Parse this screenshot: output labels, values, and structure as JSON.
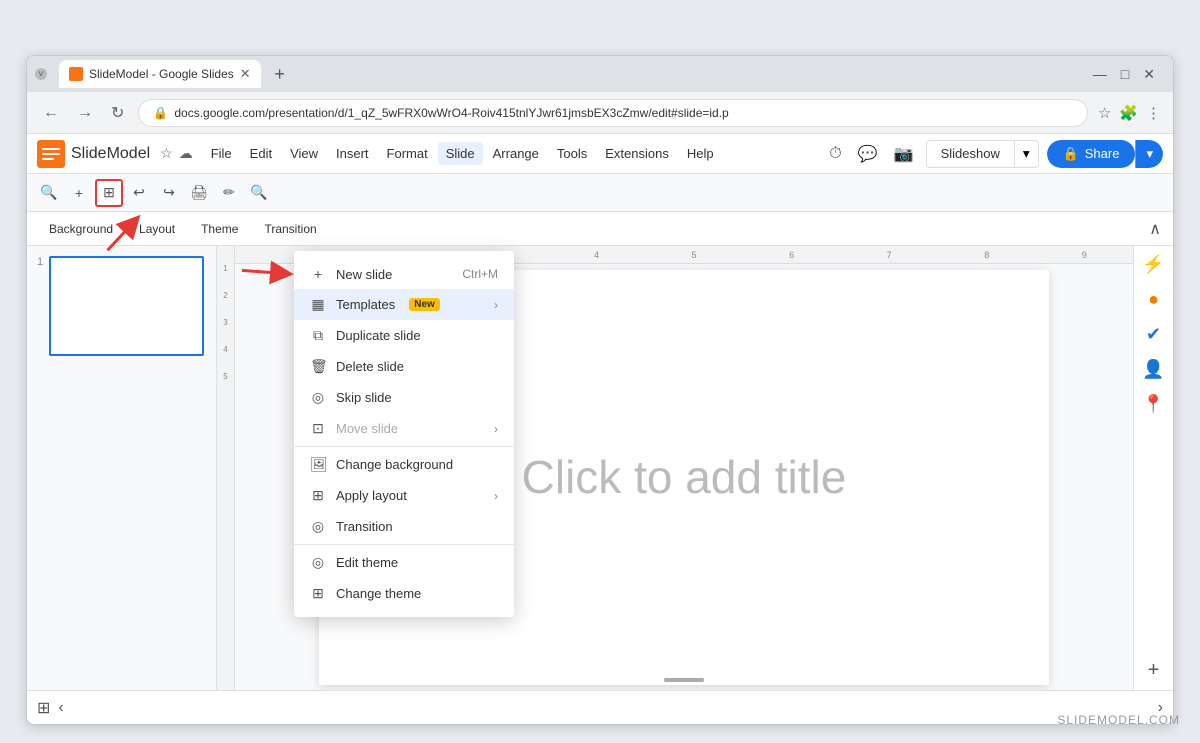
{
  "browser": {
    "tab_title": "SlideModel - Google Slides",
    "url": "docs.google.com/presentation/d/1_qZ_5wFRX0wWrO4-Roiv415tnlYJwr61jmsbEX3cZmw/edit#slide=id.p",
    "new_tab_icon": "+",
    "window_controls": {
      "minimize": "—",
      "maximize": "□",
      "close": "✕"
    }
  },
  "app": {
    "title": "SlideModel",
    "logo_color": "#f97316",
    "menu_items": [
      "File",
      "Edit",
      "View",
      "Insert",
      "Format",
      "Slide",
      "Arrange",
      "Tools",
      "Extensions",
      "Help"
    ],
    "active_menu": "Slide",
    "header_right": {
      "slideshow_label": "Slideshow",
      "share_label": "Share"
    }
  },
  "toolbar": {
    "buttons": [
      "🔍",
      "+",
      "⊞",
      "↩",
      "↪",
      "🖨",
      "✂",
      "🔍"
    ]
  },
  "secondary_toolbar": {
    "items": [
      "Background",
      "Layout",
      "Theme",
      "Transition"
    ]
  },
  "slide_menu": {
    "sections": [
      {
        "items": [
          {
            "label": "New slide",
            "shortcut": "Ctrl+M",
            "icon": "+",
            "disabled": false
          },
          {
            "label": "Templates",
            "shortcut": "",
            "icon": "▦",
            "disabled": false,
            "badge": "New",
            "highlighted": true
          },
          {
            "label": "Duplicate slide",
            "shortcut": "",
            "icon": "⧉",
            "disabled": false
          },
          {
            "label": "Delete slide",
            "shortcut": "",
            "icon": "🗑",
            "disabled": false
          },
          {
            "label": "Skip slide",
            "shortcut": "",
            "icon": "◎",
            "disabled": false
          },
          {
            "label": "Move slide",
            "shortcut": "",
            "icon": "⊡",
            "disabled": true,
            "has_arrow": true
          }
        ]
      },
      {
        "items": [
          {
            "label": "Change background",
            "shortcut": "",
            "icon": "🖼",
            "disabled": false
          },
          {
            "label": "Apply layout",
            "shortcut": "",
            "icon": "⊞",
            "disabled": false,
            "has_arrow": true
          },
          {
            "label": "Transition",
            "shortcut": "",
            "icon": "◎",
            "disabled": false
          }
        ]
      },
      {
        "items": [
          {
            "label": "Edit theme",
            "shortcut": "",
            "icon": "◎",
            "disabled": false
          },
          {
            "label": "Change theme",
            "shortcut": "",
            "icon": "⊞",
            "disabled": false
          }
        ]
      }
    ]
  },
  "slide_canvas": {
    "placeholder": "Click to add title"
  },
  "ruler_marks": [
    "1",
    "2",
    "3",
    "4",
    "5",
    "6",
    "7",
    "8",
    "9"
  ],
  "watermark": "SLIDEMODEL.COM"
}
